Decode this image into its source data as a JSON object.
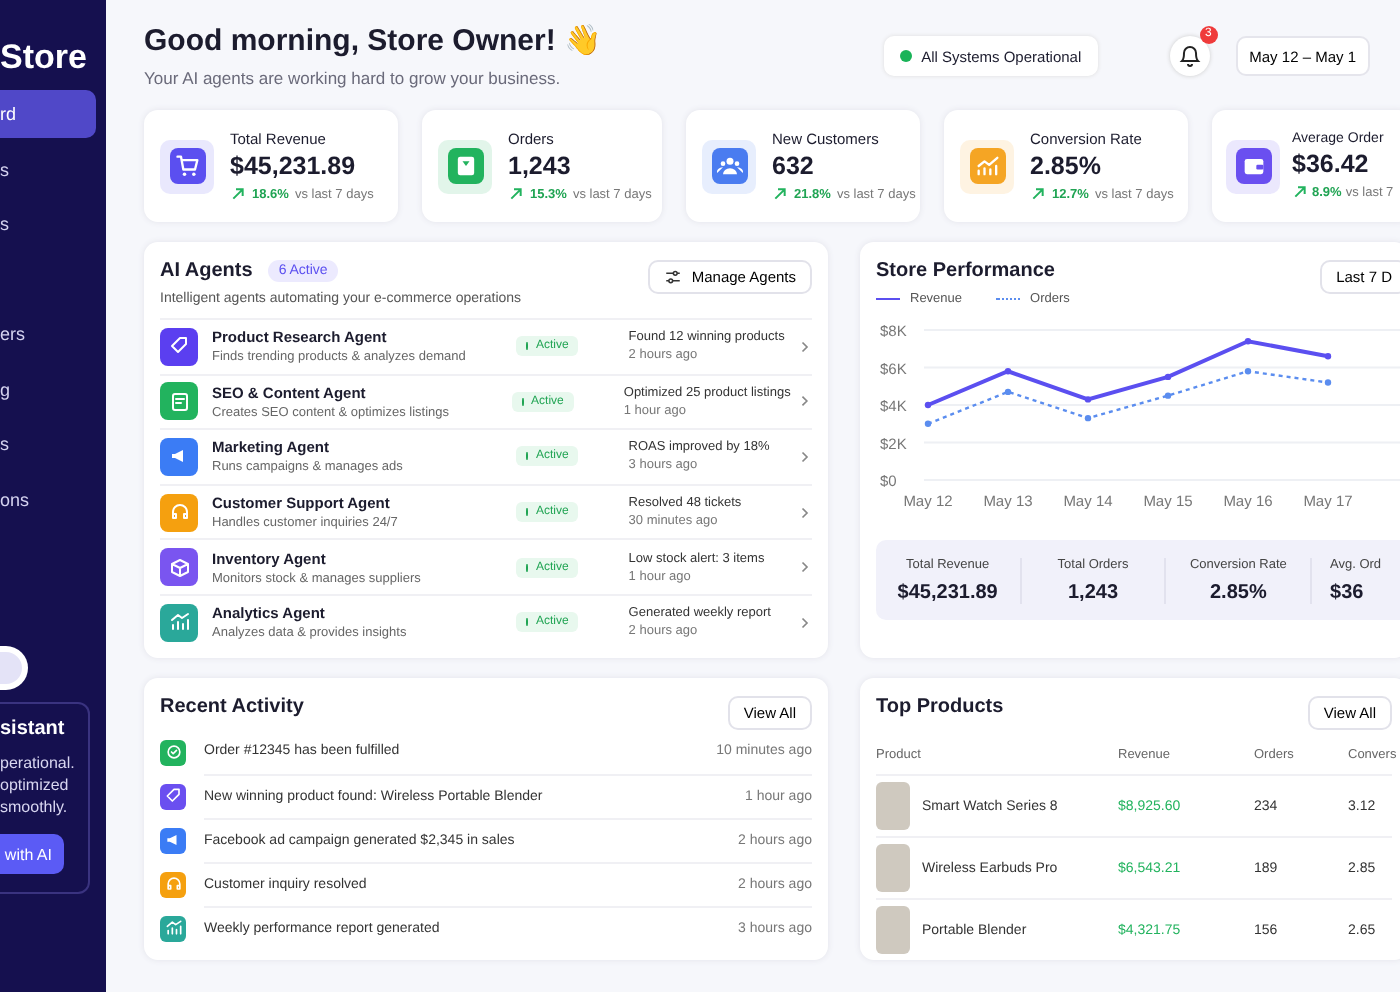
{
  "sidebar": {
    "title": "Store",
    "items": [
      {
        "label": "rd",
        "selected": true
      },
      {
        "label": "s",
        "selected": false
      },
      {
        "label": "s",
        "selected": false
      },
      {
        "label": "ers",
        "selected": false
      },
      {
        "label": "g",
        "selected": false
      },
      {
        "label": "s",
        "selected": false
      },
      {
        "label": "ons",
        "selected": false
      }
    ],
    "assistant": {
      "title": "sistant",
      "lines": [
        "perational.",
        "optimized",
        "smoothly."
      ],
      "button": "with AI"
    }
  },
  "header": {
    "greeting": "Good morning, Store Owner! 👋",
    "subtitle": "Your AI agents are working hard to grow your business.",
    "status": "All Systems Operational",
    "notifications": "3",
    "date": "May 12 – May 1"
  },
  "stats": [
    {
      "label": "Total Revenue",
      "value": "$45,231.89",
      "change": "18.6%",
      "note": "vs last 7 days",
      "color": "#5b4ff0"
    },
    {
      "label": "Orders",
      "value": "1,243",
      "change": "15.3%",
      "note": "vs last 7 days",
      "color": "#22b35e"
    },
    {
      "label": "New Customers",
      "value": "632",
      "change": "21.8%",
      "note": "vs last 7 days",
      "color": "#4a7cf0"
    },
    {
      "label": "Conversion Rate",
      "value": "2.85%",
      "change": "12.7%",
      "note": "vs last 7 days",
      "color": "#f5a524"
    },
    {
      "label": "Average Order",
      "value": "$36.42",
      "change": "8.9%",
      "note": "vs last 7",
      "color": "#6a4ff0"
    }
  ],
  "agents": {
    "title": "AI Agents",
    "badge": "6 Active",
    "subtitle": "Intelligent agents automating your e-commerce operations",
    "button": "Manage Agents",
    "items": [
      {
        "name": "Product Research Agent",
        "desc": "Finds trending products & analyzes demand",
        "status": "Active",
        "result": "Found 12 winning products",
        "time": "2 hours ago",
        "color": "#5b3ff0"
      },
      {
        "name": "SEO & Content Agent",
        "desc": "Creates SEO content & optimizes listings",
        "status": "Active",
        "result": "Optimized 25 product listings",
        "time": "1 hour ago",
        "color": "#22b35e"
      },
      {
        "name": "Marketing Agent",
        "desc": "Runs campaigns & manages ads",
        "status": "Active",
        "result": "ROAS improved by 18%",
        "time": "3 hours ago",
        "color": "#3b7cf5"
      },
      {
        "name": "Customer Support Agent",
        "desc": "Handles customer inquiries 24/7",
        "status": "Active",
        "result": "Resolved 48 tickets",
        "time": "30 minutes ago",
        "color": "#f5a00f"
      },
      {
        "name": "Inventory Agent",
        "desc": "Monitors stock & manages suppliers",
        "status": "Active",
        "result": "Low stock alert: 3 items",
        "time": "1 hour ago",
        "color": "#7a55f0"
      },
      {
        "name": "Analytics Agent",
        "desc": "Analyzes data & provides insights",
        "status": "Active",
        "result": "Generated weekly report",
        "time": "2 hours ago",
        "color": "#2aa89a"
      }
    ]
  },
  "performance": {
    "title": "Store Performance",
    "button": "Last 7 D",
    "chart_data": {
      "type": "line",
      "grid": true,
      "categories": [
        "May 12",
        "May 13",
        "May 14",
        "May 15",
        "May 16",
        "May 17"
      ],
      "ylim": [
        0,
        8000
      ],
      "yticks": [
        {
          "value": 0,
          "label": "$0"
        },
        {
          "value": 2000,
          "label": "$2K"
        },
        {
          "value": 4000,
          "label": "$4K"
        },
        {
          "value": 6000,
          "label": "$6K"
        },
        {
          "value": 8000,
          "label": "$8K"
        }
      ],
      "series": [
        {
          "name": "Revenue",
          "color": "#5b4ff0",
          "marker": "circle",
          "line_style": "solid",
          "values": [
            4000,
            5800,
            4300,
            5500,
            7400,
            6600
          ]
        },
        {
          "name": "Orders",
          "color": "#5b8def",
          "marker": "circle",
          "line_style": "dashed",
          "values": [
            3000,
            4700,
            3300,
            4500,
            5800,
            5200
          ]
        }
      ]
    },
    "summary": [
      {
        "label": "Total Revenue",
        "value": "$45,231.89"
      },
      {
        "label": "Total Orders",
        "value": "1,243"
      },
      {
        "label": "Conversion Rate",
        "value": "2.85%"
      },
      {
        "label": "Avg. Ord",
        "value": "$36"
      }
    ]
  },
  "activity": {
    "title": "Recent Activity",
    "button": "View All",
    "items": [
      {
        "text": "Order #12345 has been fulfilled",
        "time": "10 minutes ago",
        "color": "#22b35e"
      },
      {
        "text": "New winning product found: Wireless Portable Blender",
        "time": "1 hour ago",
        "color": "#6a4ff0"
      },
      {
        "text": "Facebook ad campaign generated $2,345 in sales",
        "time": "2 hours ago",
        "color": "#3b7cf5"
      },
      {
        "text": "Customer inquiry resolved",
        "time": "2 hours ago",
        "color": "#f5a00f"
      },
      {
        "text": "Weekly performance report generated",
        "time": "3 hours ago",
        "color": "#2aa89a"
      }
    ]
  },
  "products": {
    "title": "Top Products",
    "button": "View All",
    "columns": [
      "Product",
      "Revenue",
      "Orders",
      "Convers"
    ],
    "rows": [
      [
        "Smart Watch Series 8",
        "$8,925.60",
        "234",
        "3.12"
      ],
      [
        "Wireless Earbuds Pro",
        "$6,543.21",
        "189",
        "2.85"
      ],
      [
        "Portable Blender",
        "$4,321.75",
        "156",
        "2.65"
      ]
    ]
  }
}
